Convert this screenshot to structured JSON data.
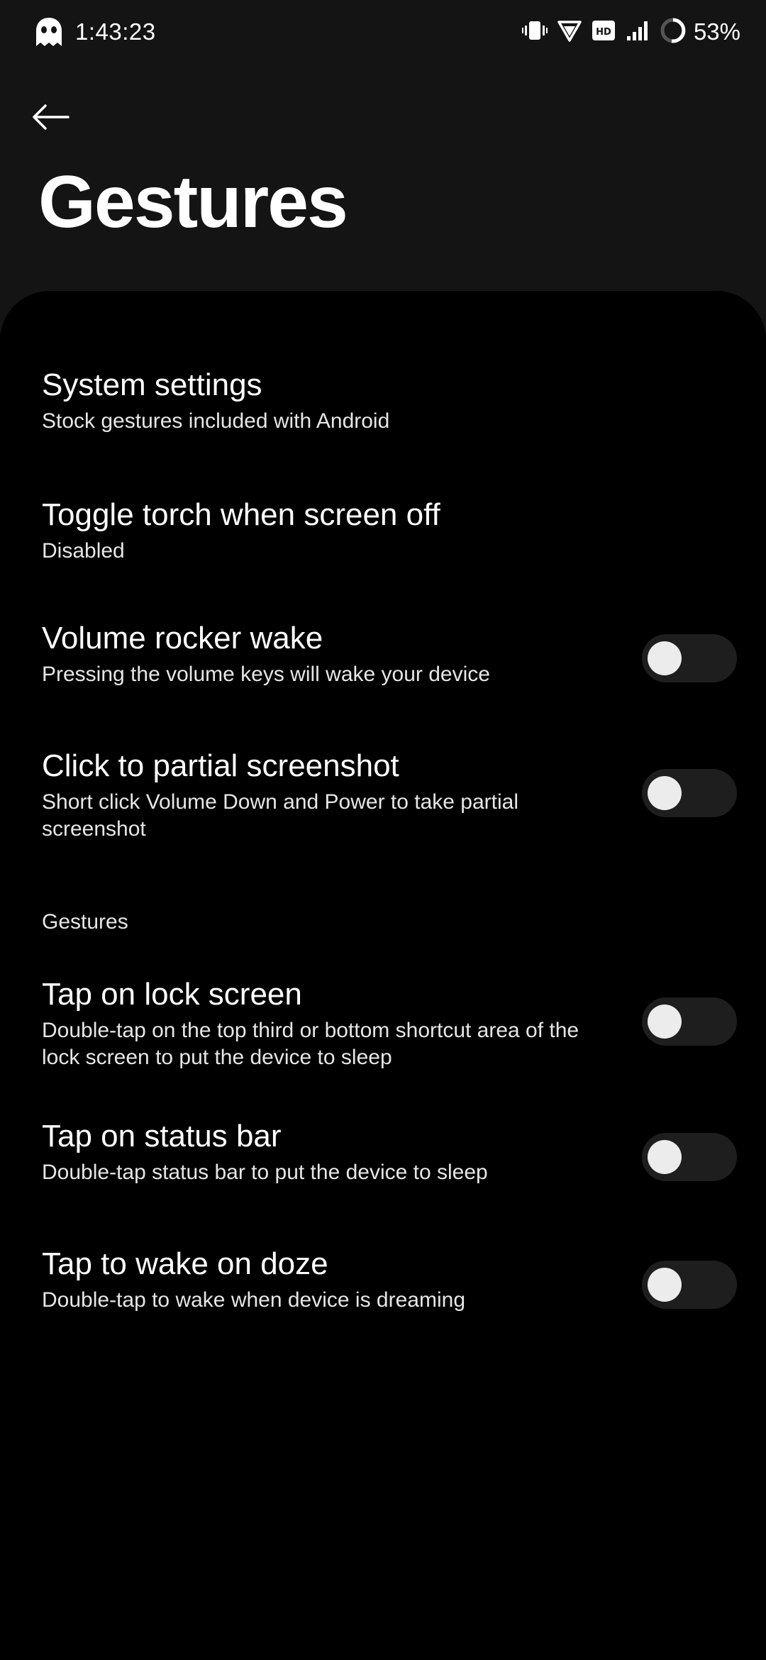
{
  "status_bar": {
    "time": "1:43:23",
    "battery_percent": "53%",
    "icons": [
      "ghost-icon",
      "vibrate-icon",
      "wifi-icon",
      "hd-icon",
      "signal-icon",
      "battery-icon"
    ]
  },
  "header": {
    "title": "Gestures",
    "back_icon": "arrow-left-icon"
  },
  "preferences": [
    {
      "title": "System settings",
      "summary": "Stock gestures included with Android"
    },
    {
      "title": "Toggle torch when screen off",
      "summary": "Disabled"
    },
    {
      "title": "Volume rocker wake",
      "summary": "Pressing the volume keys will wake your device",
      "switch_on": false
    },
    {
      "title": "Click to partial screenshot",
      "summary": "Short click Volume Down and Power to take partial screenshot",
      "switch_on": false
    }
  ],
  "gestures_category": {
    "title": "Gestures",
    "items": [
      {
        "title": "Tap on lock screen",
        "summary": "Double-tap on the top third or bottom shortcut area of the lock screen to put the device to sleep",
        "switch_on": false
      },
      {
        "title": "Tap on status bar",
        "summary": "Double-tap status bar to put the device to sleep",
        "switch_on": false
      },
      {
        "title": "Tap to wake on doze",
        "summary": "Double-tap to wake when device is dreaming",
        "switch_on": false
      }
    ]
  },
  "colors": {
    "header_background": "#141414",
    "content_background": "#000000",
    "switch_track_off": "#1e1e1e",
    "switch_thumb_off": "#ececec"
  }
}
